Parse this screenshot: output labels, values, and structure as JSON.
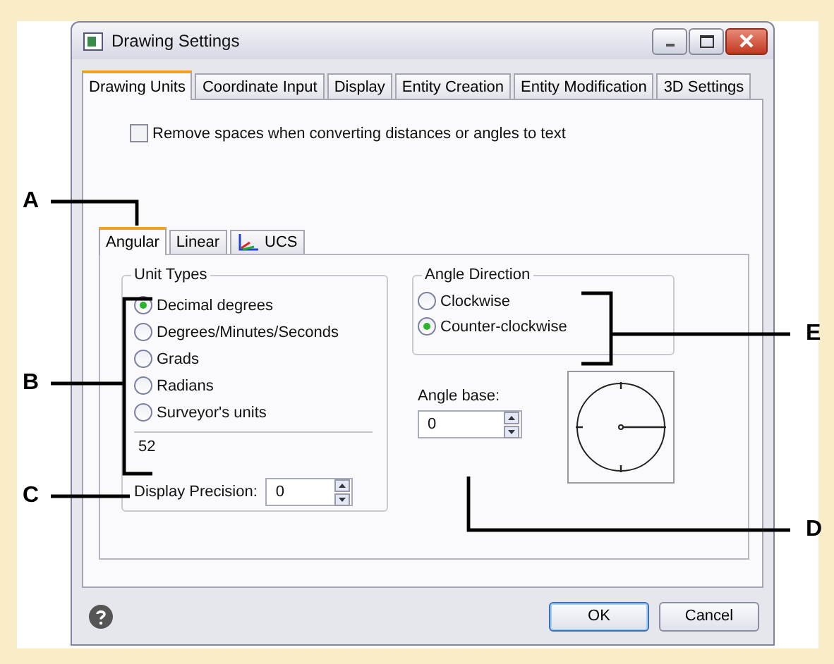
{
  "window": {
    "title": "Drawing Settings"
  },
  "tabs": [
    {
      "label": "Drawing Units",
      "selected": true
    },
    {
      "label": "Coordinate Input",
      "selected": false
    },
    {
      "label": "Display",
      "selected": false
    },
    {
      "label": "Entity Creation",
      "selected": false
    },
    {
      "label": "Entity Modification",
      "selected": false
    },
    {
      "label": "3D Settings",
      "selected": false
    }
  ],
  "remove_spaces": {
    "label": "Remove spaces when converting distances or angles to text",
    "checked": false
  },
  "subtabs": [
    {
      "label": "Angular",
      "selected": true,
      "kind": "text"
    },
    {
      "label": "Linear",
      "selected": false,
      "kind": "text"
    },
    {
      "label": "UCS",
      "selected": false,
      "kind": "icon"
    }
  ],
  "unit_types": {
    "title": "Unit Types",
    "options": [
      {
        "label": "Decimal degrees",
        "selected": true
      },
      {
        "label": "Degrees/Minutes/Seconds",
        "selected": false
      },
      {
        "label": "Grads",
        "selected": false
      },
      {
        "label": "Radians",
        "selected": false
      },
      {
        "label": "Surveyor's units",
        "selected": false
      }
    ],
    "sample": "52"
  },
  "display_precision": {
    "label": "Display Precision:",
    "value": "0"
  },
  "angle_direction": {
    "title": "Angle Direction",
    "options": [
      {
        "label": "Clockwise",
        "selected": false
      },
      {
        "label": "Counter-clockwise",
        "selected": true
      }
    ]
  },
  "angle_base": {
    "label": "Angle base:",
    "value": "0"
  },
  "buttons": [
    {
      "label": "OK",
      "default": true
    },
    {
      "label": "Cancel",
      "default": false
    }
  ],
  "callouts": [
    {
      "label": "A"
    },
    {
      "label": "B"
    },
    {
      "label": "C"
    },
    {
      "label": "D"
    },
    {
      "label": "E"
    }
  ]
}
